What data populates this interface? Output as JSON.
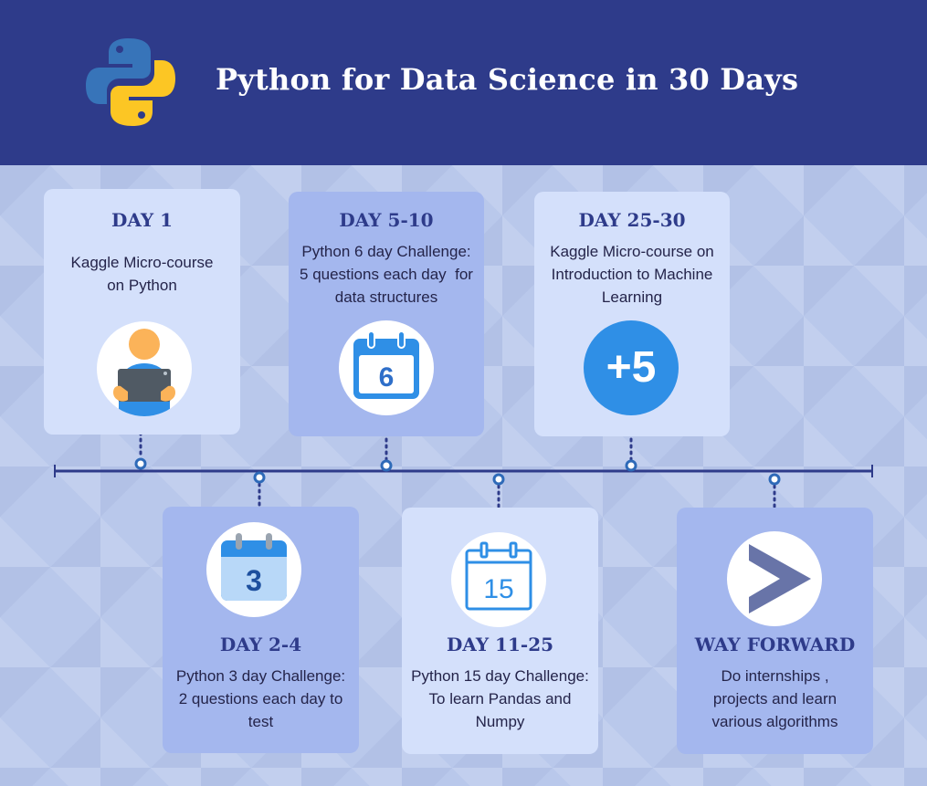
{
  "header": {
    "title": "Python for Data Science in 30 Days",
    "logo_icon": "python-logo-icon",
    "background_color": "#2e3b8a"
  },
  "colors": {
    "accent": "#2e3b8a",
    "card_light": "#d4e0fb",
    "card_mid": "#a4b7ee",
    "icon_blue": "#2f8fe6"
  },
  "milestones": [
    {
      "label": "DAY 1",
      "description": [
        "Kaggle Micro-course",
        "on Python"
      ],
      "icon": "person-laptop-icon"
    },
    {
      "label": "DAY 2-4",
      "description": [
        "Python 3 day Challenge:",
        "2 questions each day to",
        "test"
      ],
      "icon": "calendar-icon",
      "icon_text": "3"
    },
    {
      "label": "DAY 5-10",
      "description": [
        "Python 6 day Challenge:",
        "5 questions each day  for",
        "data structures"
      ],
      "icon": "calendar-icon",
      "icon_text": "6"
    },
    {
      "label": "DAY 11-25",
      "description": [
        "Python 15 day Challenge:",
        "To learn Pandas and",
        "Numpy"
      ],
      "icon": "calendar-outline-icon",
      "icon_text": "15"
    },
    {
      "label": "DAY 25-30",
      "description": [
        "Kaggle Micro-course on",
        "Introduction to Machine",
        "Learning"
      ],
      "icon": "plus-five-icon",
      "icon_text": "+5"
    },
    {
      "label": "WAY FORWARD",
      "description": [
        "Do internships ,",
        "projects and learn",
        "various algorithms"
      ],
      "icon": "chevron-right-icon"
    }
  ]
}
